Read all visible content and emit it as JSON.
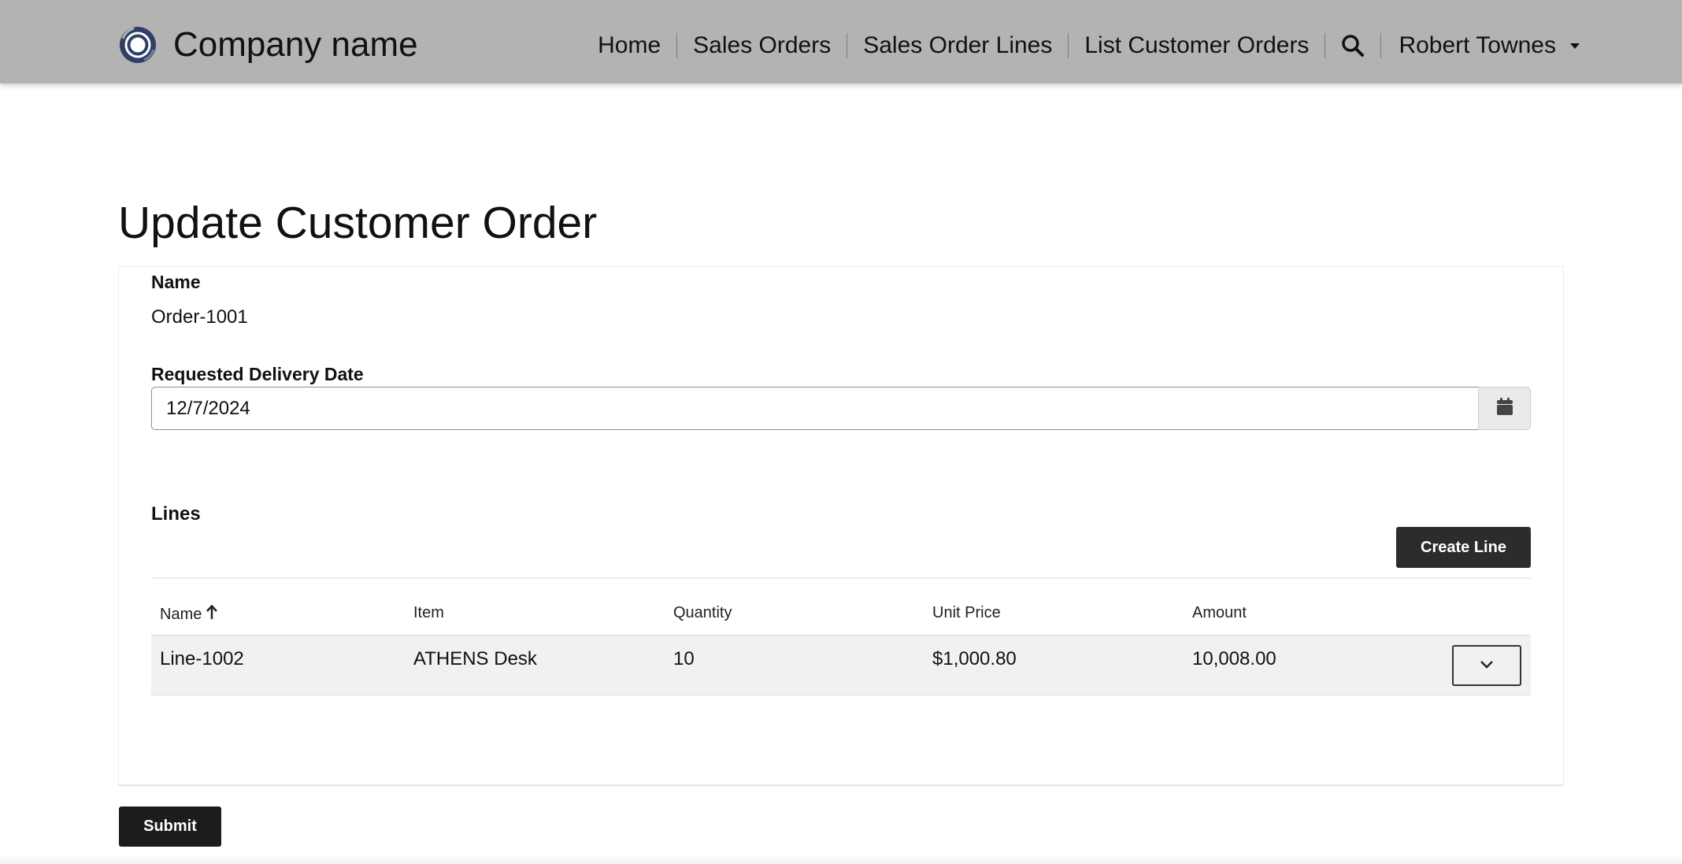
{
  "header": {
    "brand_name": "Company name",
    "logo_icon": "concentric-ring-logo",
    "nav": [
      {
        "label": "Home"
      },
      {
        "label": "Sales Orders"
      },
      {
        "label": "Sales Order Lines"
      },
      {
        "label": "List Customer Orders"
      }
    ],
    "search_icon": "search-icon",
    "user": {
      "name": "Robert Townes",
      "menu_icon": "caret-down-icon"
    }
  },
  "page": {
    "title": "Update Customer Order"
  },
  "form": {
    "name": {
      "label": "Name",
      "value": "Order-1001"
    },
    "requested_delivery_date": {
      "label": "Requested Delivery Date",
      "value": "12/7/2024",
      "picker_icon": "calendar-icon"
    },
    "lines": {
      "heading": "Lines",
      "create_label": "Create Line",
      "columns": [
        {
          "label": "Name",
          "sort": "ascending"
        },
        {
          "label": "Item"
        },
        {
          "label": "Quantity"
        },
        {
          "label": "Unit Price"
        },
        {
          "label": "Amount"
        }
      ],
      "rows": [
        {
          "name": "Line-1002",
          "item": "ATHENS Desk",
          "quantity": "10",
          "unit_price": "$1,000.80",
          "amount": "10,008.00",
          "action_icon": "chevron-down-icon"
        }
      ]
    },
    "submit_label": "Submit"
  },
  "colors": {
    "header_bg": "#b3b3b2",
    "logo_ring": "#2f3f66",
    "button_bg": "#2c2c2c",
    "row_bg": "#f1f1f1"
  }
}
